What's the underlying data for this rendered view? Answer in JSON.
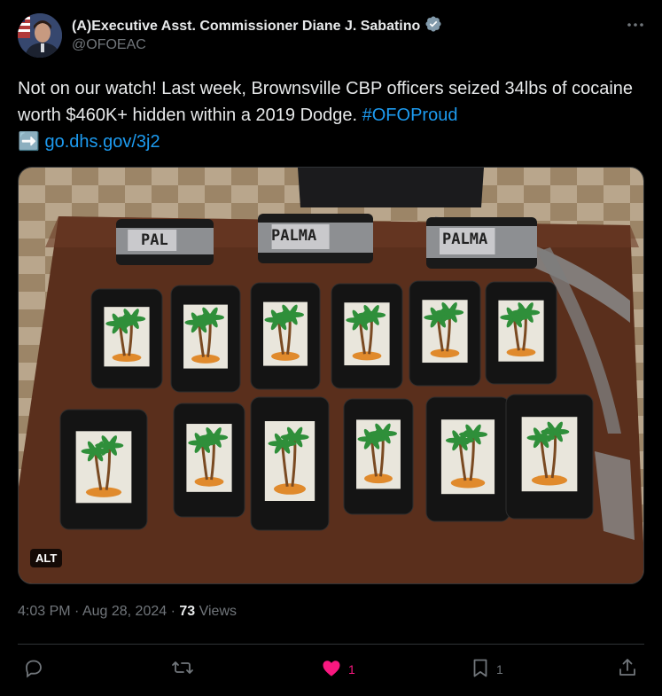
{
  "author": {
    "name": "(A)Executive Asst. Commissioner Diane J. Sabatino",
    "handle": "@OFOEAC",
    "verified_badge_color": "#829aab"
  },
  "tweet": {
    "text_main": "Not on our watch! Last week, Brownsville CBP officers seized 34lbs of cocaine worth $460K+ hidden within a 2019 Dodge.",
    "hashtag": "#OFOProud",
    "link_emoji": "➡️",
    "link": "go.dhs.gov/3j2"
  },
  "media": {
    "alt_badge": "ALT",
    "package_label": "PALMA"
  },
  "meta": {
    "time": "4:03 PM",
    "separator": " · ",
    "date": "Aug 28, 2024",
    "views_count": "73",
    "views_label": " Views"
  },
  "actions": {
    "reply_count": "",
    "retweet_count": "",
    "like_count": "1",
    "bookmark_count": "1"
  },
  "colors": {
    "background": "#000000",
    "text": "#e7e9ea",
    "secondary": "#71767b",
    "link": "#1d9bf0",
    "like": "#f91880",
    "border": "#2f3336"
  }
}
